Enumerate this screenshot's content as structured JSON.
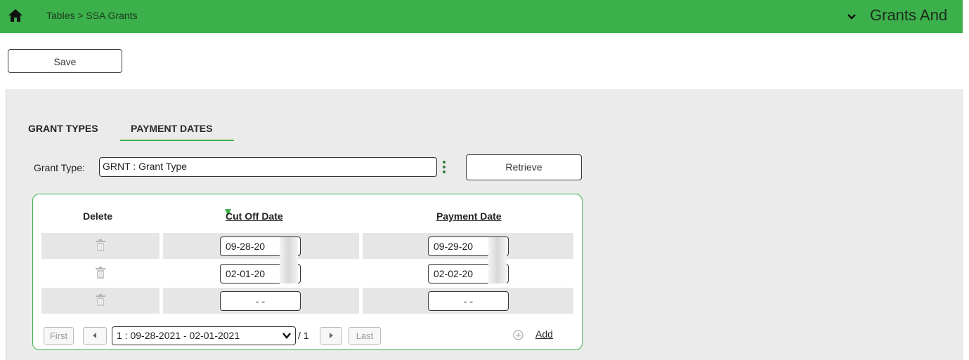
{
  "header": {
    "breadcrumb": "Tables > SSA Grants",
    "app_title": "Grants And"
  },
  "toolbar": {
    "save_label": "Save"
  },
  "tabs": [
    {
      "label": "GRANT TYPES",
      "active": false
    },
    {
      "label": "PAYMENT DATES",
      "active": true
    }
  ],
  "filter": {
    "grant_type_label": "Grant Type:",
    "grant_type_value": "GRNT : Grant Type",
    "retrieve_label": "Retrieve"
  },
  "grid": {
    "columns": [
      "Delete",
      "Cut Off Date",
      "Payment Date"
    ],
    "rows": [
      {
        "cut_off": "09-28-20",
        "payment": "09-29-20"
      },
      {
        "cut_off": "02-01-20",
        "payment": "02-02-20"
      },
      {
        "cut_off": "- -",
        "payment": "- -"
      }
    ]
  },
  "pager": {
    "first": "First",
    "last": "Last",
    "selected_page": "1 : 09-28-2021 - 02-01-2021",
    "total": "/ 1",
    "add_label": "Add"
  },
  "colors": {
    "accent": "#3cb04b",
    "background": "#ebebeb"
  }
}
